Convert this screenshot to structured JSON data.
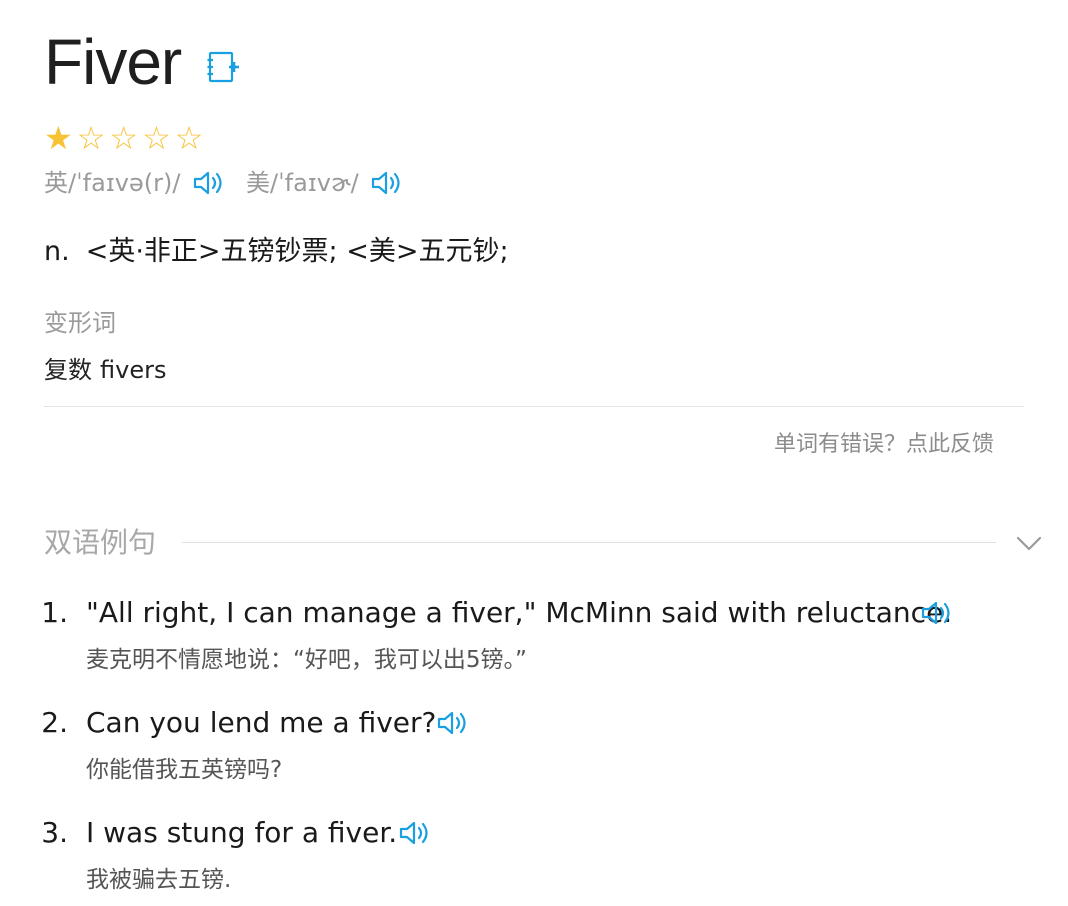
{
  "word": {
    "headword": "Fiver",
    "add_to_wordbook_icon": "add-note-icon",
    "star_rating": 1,
    "star_total": 5
  },
  "pronunciation": {
    "uk": "英/ˈfaɪvə(r)/",
    "us": "美/ˈfaɪvɚ/",
    "speaker_icon": "speaker-icon",
    "icon_color": "#1a9fe0"
  },
  "definition": {
    "pos": "n.",
    "meaning": "<英·非正>五镑钞票; <美>五元钞;"
  },
  "word_forms": {
    "title": "变形词",
    "items": [
      {
        "label": "复数",
        "value": "fivers"
      }
    ]
  },
  "feedback_link": "单词有错误？点此反馈",
  "examples": {
    "title": "双语例句",
    "collapse_icon": "chevron-down-icon",
    "items": [
      {
        "num": "1.",
        "en": "\"All right, I can manage a fiver,\" McMinn said with reluctance.",
        "zh": "麦克明不情愿地说：“好吧，我可以出5镑。”"
      },
      {
        "num": "2.",
        "en": "Can you lend me a fiver?",
        "zh": "你能借我五英镑吗?"
      },
      {
        "num": "3.",
        "en": "I was stung for a fiver.",
        "zh": "我被骗去五镑."
      }
    ]
  }
}
